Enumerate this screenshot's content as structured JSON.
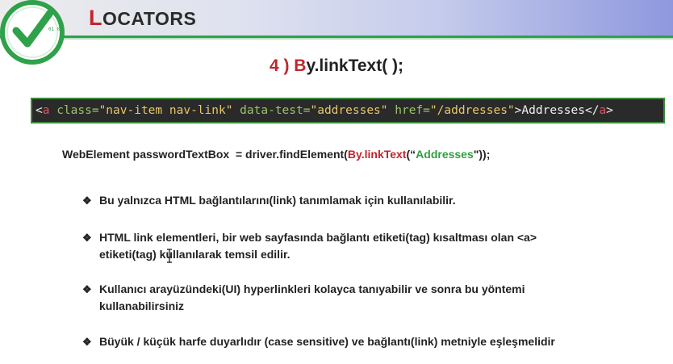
{
  "header": {
    "title_first": "L",
    "title_rest": "OCATORS",
    "logo_badge": "01 01"
  },
  "method": {
    "prefix": "4 ) ",
    "by": "B",
    "rest": "y.linkText( );"
  },
  "code": {
    "lt": "<",
    "a_open": "a",
    "attr_class": " class=",
    "val_class": "\"nav-item nav-link\"",
    "attr_datatest": " data-test=",
    "val_datatest": "\"addresses\"",
    "attr_href": " href=",
    "val_href": "\"/addresses\"",
    "gt_text": ">Addresses</",
    "a_close": "a",
    "gt": ">"
  },
  "java": {
    "prefix": "WebElement passwordTextBox  = driver.findElement(",
    "by": "By.linkText",
    "open": "(“",
    "arg": "Addresses",
    "close": "\"));"
  },
  "bullets": [
    {
      "mark": "❖",
      "lines": [
        "Bu yalnızca HTML bağlantılarını(link) tanımlamak için kullanılabilir."
      ]
    },
    {
      "mark": "❖",
      "lines": [
        "HTML link elementleri, bir web sayfasında bağlantı etiketi(tag) kısaltması olan <a>",
        "etiketi(tag) kullanılarak temsil edilir."
      ]
    },
    {
      "mark": "❖",
      "lines": [
        "Kullanıcı arayüzündeki(UI) hyperlinkleri kolayca tanıyabilir ve sonra bu yöntemi",
        "kullanabilirsiniz"
      ]
    },
    {
      "mark": "❖",
      "lines": [
        "Büyük / küçük harfe duyarlıdır (case sensitive) ve bağlantı(link) metniyle eşleşmelidir"
      ]
    }
  ]
}
